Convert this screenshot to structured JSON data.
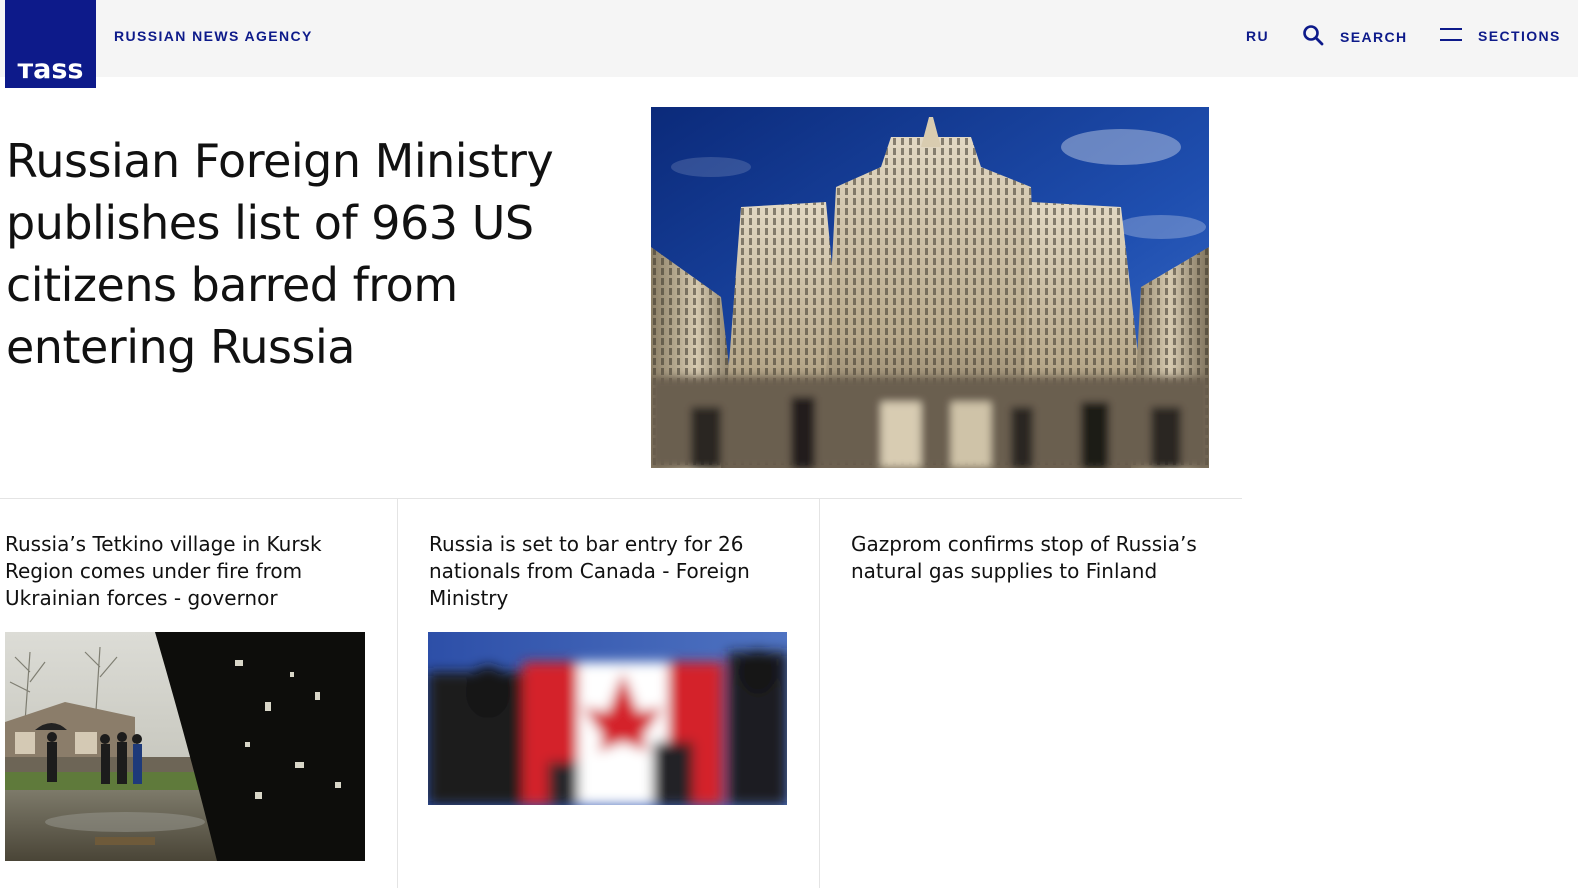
{
  "header": {
    "logo_text": "тass",
    "agency_label": "RUSSIAN NEWS AGENCY",
    "lang_label": "RU",
    "search_label": "SEARCH",
    "sections_label": "SECTIONS",
    "brand_color": "#0d1a8a"
  },
  "lead": {
    "title": "Russian Foreign Ministry publishes list of 963 US citizens barred from entering Russia",
    "image_icon": "ministry-building-photo"
  },
  "cards": [
    {
      "title": "Russia’s Tetkino village in Kursk Region comes under fire from Ukrainian forces - governor",
      "image_icon": "damaged-village-photo"
    },
    {
      "title": "Russia is set to bar entry for 26 nationals from Canada - Foreign Ministry",
      "image_icon": "canada-flag-crowd-photo"
    },
    {
      "title": "Gazprom confirms stop of Russia’s natural gas supplies to Finland"
    }
  ]
}
